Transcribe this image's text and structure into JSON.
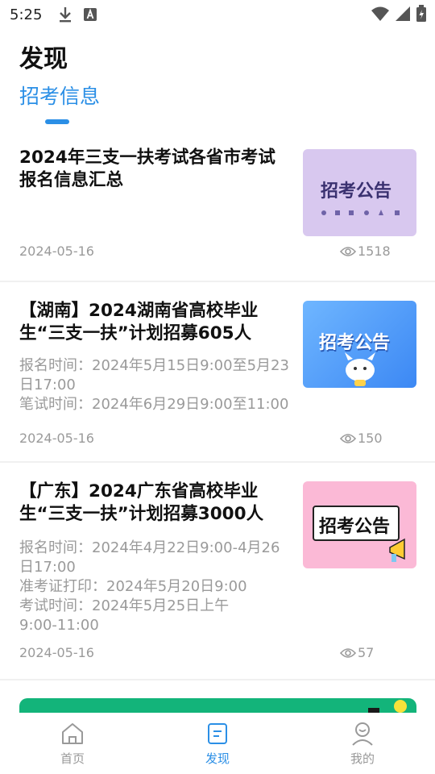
{
  "status_bar": {
    "time": "5:25"
  },
  "header": {
    "title": "发现"
  },
  "tabs": [
    {
      "label": "招考信息",
      "active": true
    }
  ],
  "articles": [
    {
      "title_lines": [
        "2024年三支一扶考试各省市考试",
        "报名信息汇总"
      ],
      "details": [],
      "date": "2024-05-16",
      "views": "1518",
      "thumb_text": "招考公告"
    },
    {
      "title_lines": [
        "【湖南】2024湖南省高校毕业",
        "生“三支一扶”计划招募605人"
      ],
      "details": [
        "报名时间：2024年5月15日9:00至5月23",
        "日17:00",
        "笔试时间：2024年6月29日9:00至11:00"
      ],
      "date": "2024-05-16",
      "views": "150",
      "thumb_text": "招考公告"
    },
    {
      "title_lines": [
        "【广东】2024广东省高校毕业",
        "生“三支一扶”计划招募3000人"
      ],
      "details": [
        "报名时间：2024年4月22日9:00-4月26",
        "日17:00",
        "准考证打印：2024年5月20日9:00",
        "考试时间：2024年5月25日上午",
        "9:00-11:00"
      ],
      "date": "2024-05-16",
      "views": "57",
      "thumb_text": "招考公告"
    }
  ],
  "bottom_nav": [
    {
      "label": "首页",
      "icon": "home-icon",
      "active": false
    },
    {
      "label": "发现",
      "icon": "discover-icon",
      "active": true
    },
    {
      "label": "我的",
      "icon": "profile-icon",
      "active": false
    }
  ],
  "colors": {
    "accent": "#2b8fe6",
    "muted": "#9a9a9a",
    "banner": "#13b47a"
  }
}
